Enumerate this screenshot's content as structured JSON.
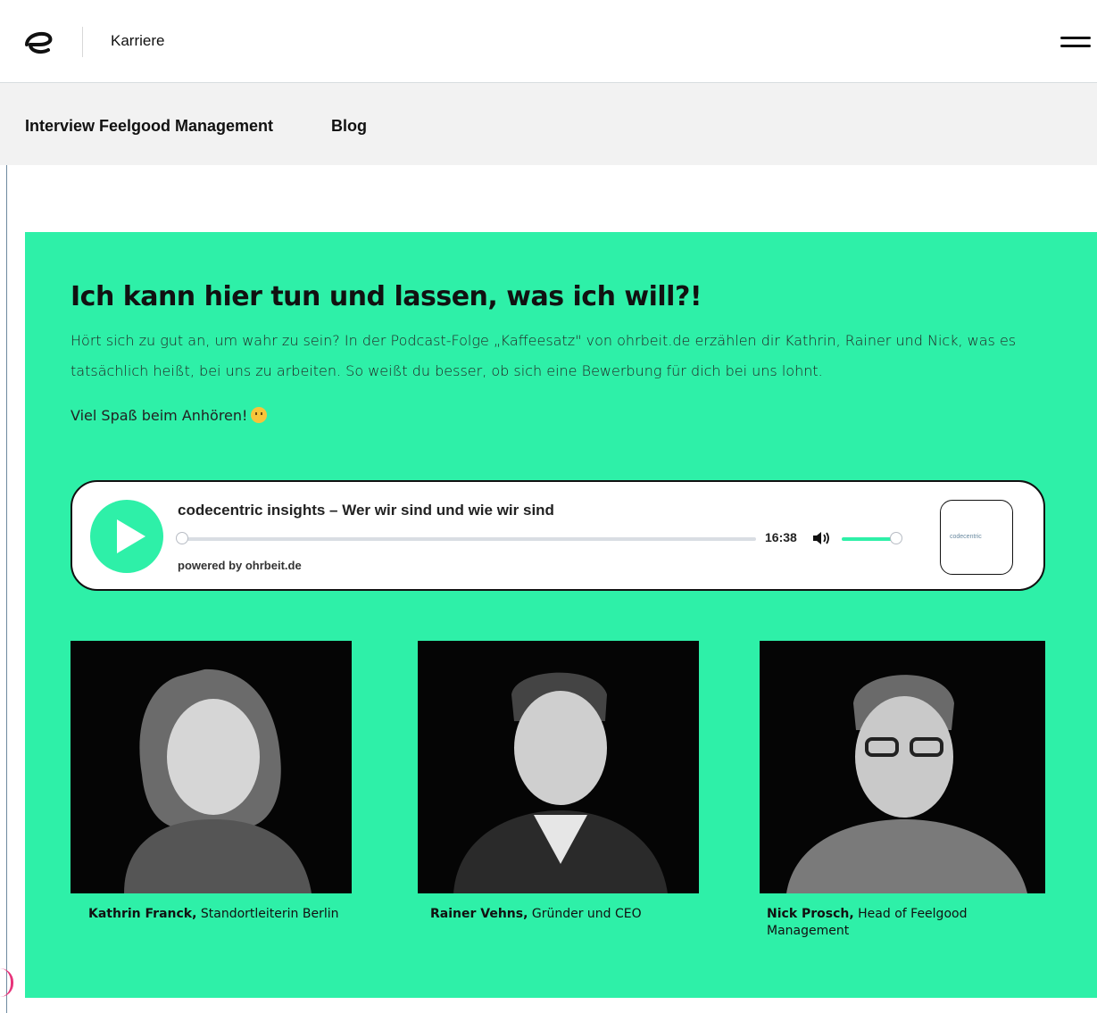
{
  "header": {
    "section_label": "Karriere",
    "logo_icon": "codecentric-logo-icon",
    "menu_icon": "hamburger-menu-icon"
  },
  "subnav": {
    "items": [
      {
        "label": "Interview Feelgood Management"
      },
      {
        "label": "Blog"
      }
    ]
  },
  "colors": {
    "accent": "#2ef0a8",
    "frame": "#6e8aa0",
    "pink": "#e8337a"
  },
  "hero": {
    "headline": "Ich kann hier tun und lassen, was ich will?!",
    "intro": "Hört sich zu gut an, um wahr zu sein? In der Podcast-Folge „Kaffeesatz\" von ohrbeit.de erzählen dir Kathrin, Rainer und Nick, was es tatsächlich heißt, bei uns zu arbeiten. So weißt du besser, ob sich eine Bewerbung für dich bei uns lohnt.",
    "fun": "Viel Spaß beim Anhören!"
  },
  "player": {
    "title": "codecentric insights – Wer wir sind und wie wir sind",
    "duration": "16:38",
    "powered_by": "powered by ohrbeit.de",
    "cover_label": "codecentric",
    "progress": 0,
    "volume": 1
  },
  "people": [
    {
      "name": "Kathrin Franck,",
      "role": "Standortleiterin Berlin"
    },
    {
      "name": "Rainer Vehns,",
      "role": "Gründer und CEO"
    },
    {
      "name": "Nick Prosch,",
      "role": "Head of Feelgood Management"
    }
  ]
}
